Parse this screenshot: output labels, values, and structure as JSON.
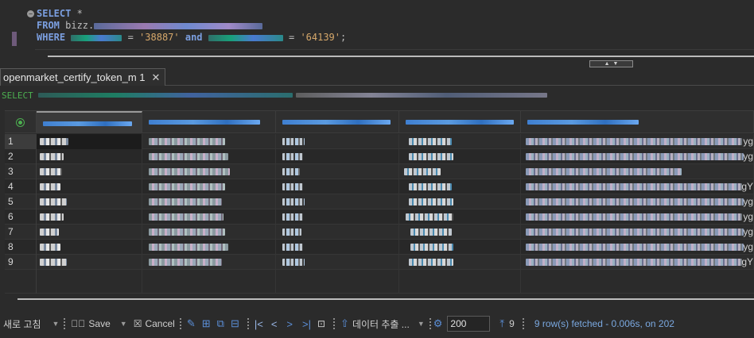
{
  "editor": {
    "fold_icon": "minus-circle-icon",
    "line1_keyword": "SELECT",
    "line1_rest": " *",
    "line2_keyword": "FROM",
    "line2_rest": " bizz.",
    "line3_keyword": "WHERE",
    "line3_eq1": " = ",
    "line3_val1": "'38887'",
    "line3_and": " and ",
    "line3_eq2": " = ",
    "line3_val2": "'64139'",
    "line3_end": ";"
  },
  "splitter": {
    "icons": [
      "triangle-up-icon",
      "triangle-down-icon"
    ]
  },
  "tab": {
    "label": "openmarket_certify_token_m 1",
    "close": "✕"
  },
  "query_preview": {
    "prefix": "SELECT"
  },
  "grid": {
    "row_numbers": [
      "1",
      "2",
      "3",
      "4",
      "5",
      "6",
      "7",
      "8",
      "9"
    ],
    "last_col_tail": [
      "yg",
      "yg",
      "",
      "gY",
      "yg",
      "yg",
      "yg",
      "yg",
      "gY"
    ]
  },
  "toolbar": {
    "refresh_label": "새로 고침",
    "save_label": "Save",
    "cancel_label": "Cancel",
    "export_label": "데이터 추출 ...",
    "fetch_size": "200",
    "row_count": "9",
    "status": "9 row(s) fetched - 0.006s, on 202"
  },
  "colors": {
    "keyword": "#7b9fe0",
    "string": "#d6a86a",
    "accent_green": "#4caf50",
    "status_blue": "#7aa8e0"
  }
}
